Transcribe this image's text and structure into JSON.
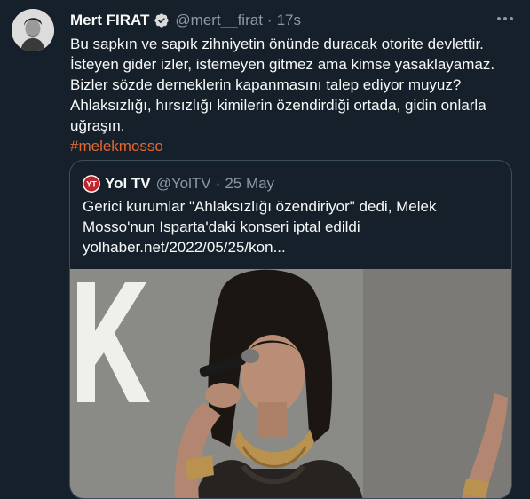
{
  "tweet": {
    "author_name": "Mert FIRAT",
    "handle": "@mert__firat",
    "separator": "·",
    "time": "17s",
    "lines": [
      "Bu sapkın ve sapık zihniyetin önünde duracak otorite devlettir.",
      "İsteyen gider izler, istemeyen gitmez ama kimse yasaklayamaz.",
      "Bizler sözde derneklerin kapanmasını talep ediyor muyuz?",
      "Ahlaksızlığı, hırsızlığı kimilerin özendirdiği ortada, gidin onlarla",
      "uğraşın."
    ],
    "hashtag": "#melekmosso",
    "verified_icon": "verified-badge-icon",
    "more_icon": "more-options-icon"
  },
  "quote": {
    "source_logo_text": "YT",
    "author_name": "Yol TV",
    "handle": "@YolTV",
    "separator": "·",
    "date": "25 May",
    "lines": [
      "Gerici kurumlar \"Ahlaksızlığı özendiriyor\" dedi, Melek",
      "Mosso'nun Isparta'daki konseri iptal edildi"
    ],
    "link": "yolhaber.net/2022/05/25/kon..."
  },
  "colors": {
    "background": "#15202b",
    "text": "#f7f9f9",
    "secondary_text": "#8b98a5",
    "hashtag": "#e26633",
    "verified": "#d9d9d9",
    "quote_border": "#3c4d5c",
    "yol_logo": "#c0252b"
  }
}
